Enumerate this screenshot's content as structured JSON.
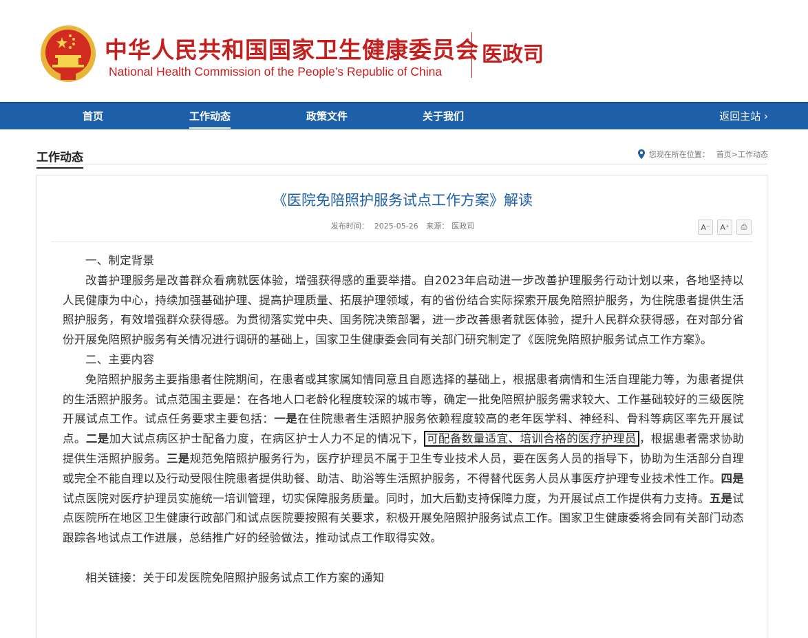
{
  "header": {
    "title_cn": "中华人民共和国国家卫生健康委员会",
    "title_en": "National Health Commission of the People’s  Republic of China",
    "dept": "医政司"
  },
  "nav": {
    "items": [
      {
        "label": "首页"
      },
      {
        "label": "工作动态",
        "active": true
      },
      {
        "label": "政策文件"
      },
      {
        "label": "关于我们"
      }
    ],
    "back_label": "返回主站 ›"
  },
  "section": {
    "title": "工作动态",
    "location_label": "您现在所在位置：",
    "breadcrumb": "首页>工作动态"
  },
  "article": {
    "title": "《医院免陪照护服务试点工作方案》解读",
    "meta_date_label": "发布时间：",
    "meta_date": "2025-05-26",
    "meta_source_label": "来源：",
    "meta_source": "医政司",
    "tools": {
      "font_small": "A⁻",
      "font_large": "A⁺",
      "print": "⎙"
    },
    "h1": "一、制定背景",
    "p1": "改善护理服务是改善群众看病就医体验，增强获得感的重要举措。自2023年启动进一步改善护理服务行动计划以来，各地坚持以人民健康为中心，持续加强基础护理、提高护理质量、拓展护理领域，有的省份结合实际探索开展免陪照护服务，为住院患者提供生活照护服务，有效增强群众获得感。为贯彻落实党中央、国务院决策部署，进一步改善患者就医体验，提升人民群众获得感，在对部分省份开展免陪照护服务有关情况进行调研的基础上，国家卫生健康委会同有关部门研究制定了《医院免陪照护服务试点工作方案》。",
    "h2": "二、主要内容",
    "p2_a": "免陪照护服务主要指患者住院期间，在患者或其家属知情同意且自愿选择的基础上，根据患者病情和生活自理能力等，为患者提供的生活照护服务。试点范围主要是：在各地人口老龄化程度较深的城市等，确定一批免陪照护服务需求较大、工作基础较好的三级医院开展试点工作。试点任务要求主要包括：",
    "kw1": "一是",
    "p2_b": "在住院患者生活照护服务依赖程度较高的老年医学科、神经科、骨科等病区率先开展试点。",
    "kw2": "二是",
    "p2_c": "加大试点病区护士配备力度，在病区护士人力不足的情况下，",
    "p2_boxed": "可配备数量适宜、培训合格的医疗护理员",
    "p2_d": "，根据患者需求协助提供生活照护服务。",
    "kw3": "三是",
    "p2_e": "规范免陪照护服务行为，医疗护理员不属于卫生专业技术人员，要在医务人员的指导下，协助为生活部分自理或完全不能自理以及行动受限住院患者提供助餐、助洁、助浴等生活照护服务，不得替代医务人员从事医疗护理专业技术性工作。",
    "kw4": "四是",
    "p2_f": "试点医院对医疗护理员实施统一培训管理，切实保障服务质量。同时，加大后勤支持保障力度，为开展试点工作提供有力支持。",
    "kw5": "五是",
    "p2_g": "试点医院所在地区卫生健康行政部门和试点医院要按照有关要求，积极开展免陪照护服务试点工作。国家卫生健康委将会同有关部门动态跟踪各地试点工作进展，总结推广好的经验做法，推动试点工作取得实效。",
    "related_label": "相关链接：",
    "related_link": "关于印发医院免陪照护服务试点工作方案的通知"
  },
  "colors": {
    "brand_red": "#c41f1f",
    "nav_blue": "#1d5fa8"
  }
}
